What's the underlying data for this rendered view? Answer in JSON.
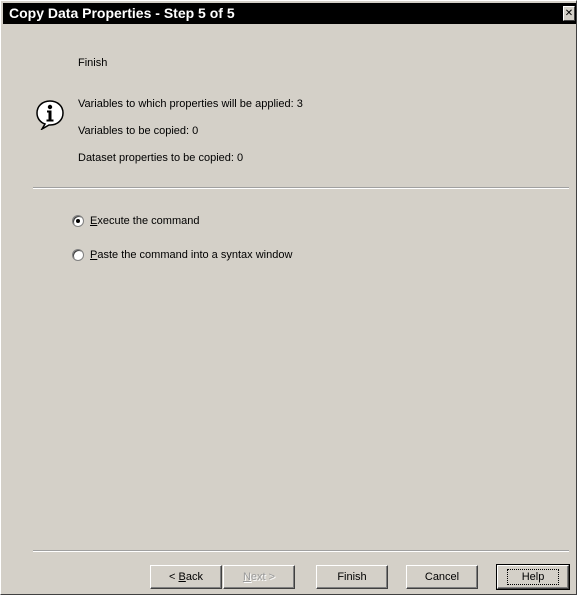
{
  "window": {
    "title": "Copy Data Properties - Step 5 of 5",
    "close_glyph": "✕"
  },
  "step": {
    "title": "Finish"
  },
  "info": {
    "icon": "info-icon",
    "lines": [
      "Variables to which properties will be applied: 3",
      "Variables to be copied: 0",
      "Dataset properties to be copied: 0"
    ]
  },
  "options": [
    {
      "mnemonic": "E",
      "rest": "xecute the command",
      "selected": true
    },
    {
      "mnemonic": "P",
      "rest": "aste the command into a syntax window",
      "selected": false
    }
  ],
  "buttons": {
    "back": {
      "prefix": "< ",
      "mnemonic": "B",
      "rest": "ack"
    },
    "next": {
      "mnemonic": "N",
      "rest": "ext >",
      "enabled": false
    },
    "finish": "Finish",
    "cancel": "Cancel",
    "help": "Help"
  }
}
